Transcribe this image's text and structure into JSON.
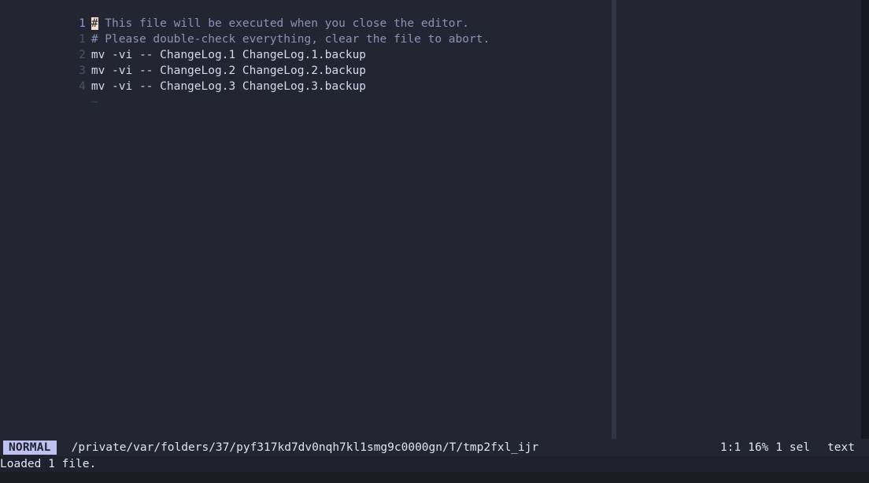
{
  "editor": {
    "lines": [
      {
        "number": "1",
        "current": true,
        "cursor_char": "#",
        "text_after_cursor": " This file will be executed when you close the editor.",
        "kind": "comment"
      },
      {
        "number": "1",
        "current": false,
        "text": "# Please double-check everything, clear the file to abort.",
        "kind": "comment"
      },
      {
        "number": "2",
        "current": false,
        "text": "mv -vi -- ChangeLog.1 ChangeLog.1.backup",
        "kind": "command"
      },
      {
        "number": "3",
        "current": false,
        "text": "mv -vi -- ChangeLog.2 ChangeLog.2.backup",
        "kind": "command"
      },
      {
        "number": "4",
        "current": false,
        "text": "mv -vi -- ChangeLog.3 ChangeLog.3.backup",
        "kind": "command"
      },
      {
        "number": "",
        "current": false,
        "text": "~",
        "kind": "tilde"
      }
    ]
  },
  "statusbar": {
    "mode": "NORMAL",
    "file_path": "/private/var/folders/37/pyf317kd7dv0nqh7kl1smg9c0000gn/T/tmp2fxl_ijr",
    "position": "1:1",
    "scroll_percent": "16%",
    "selection_count": "1 sel",
    "filetype": "text"
  },
  "messageline": {
    "text": "Loaded 1 file."
  },
  "colors": {
    "background": "#232532",
    "mode_badge_bg": "#bcc1ef",
    "mode_badge_fg": "#1f2130",
    "cursor_bg": "#f6dfd2",
    "comment_fg": "#8b93b5",
    "command_fg": "#d5d8ee",
    "gutter_fg": "#4b5268",
    "gutter_current_fg": "#8d9bd6",
    "ruler": "#2e3547"
  }
}
